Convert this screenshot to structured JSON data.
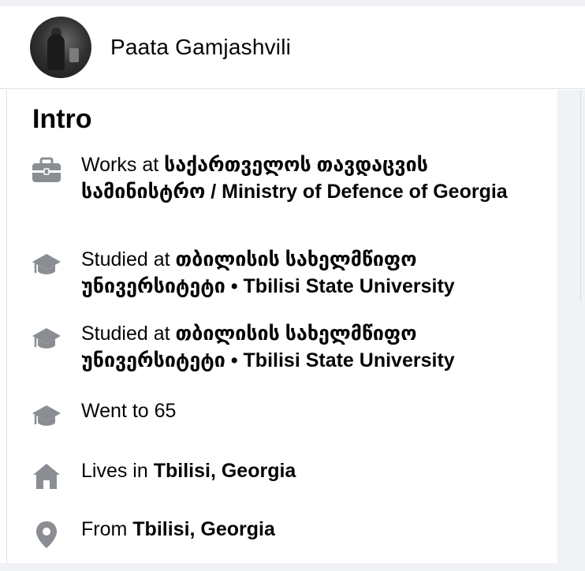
{
  "profile": {
    "name": "Paata Gamjashvili"
  },
  "intro": {
    "title": "Intro",
    "items": [
      {
        "icon": "briefcase-icon",
        "prefix": "Works at ",
        "value": "საქართველოს თავდაცვის სამინისტრო / Ministry of Defence of Georgia"
      },
      {
        "icon": "graduation-cap-icon",
        "prefix": "Studied at ",
        "value": "თბილისის სახელმწიფო უნივერსიტეტი • Tbilisi State University"
      },
      {
        "icon": "graduation-cap-icon",
        "prefix": "Studied at ",
        "value": "თბილისის სახელმწიფო უნივერსიტეტი • Tbilisi State University"
      },
      {
        "icon": "graduation-cap-icon",
        "prefix": "Went to 65",
        "value": ""
      },
      {
        "icon": "home-icon",
        "prefix": "Lives in ",
        "value": "Tbilisi, Georgia"
      },
      {
        "icon": "location-pin-icon",
        "prefix": "From ",
        "value": "Tbilisi, Georgia"
      }
    ]
  },
  "colors": {
    "icon": "#8a8d91",
    "text": "#050505",
    "rail": "#f0f2f5"
  }
}
